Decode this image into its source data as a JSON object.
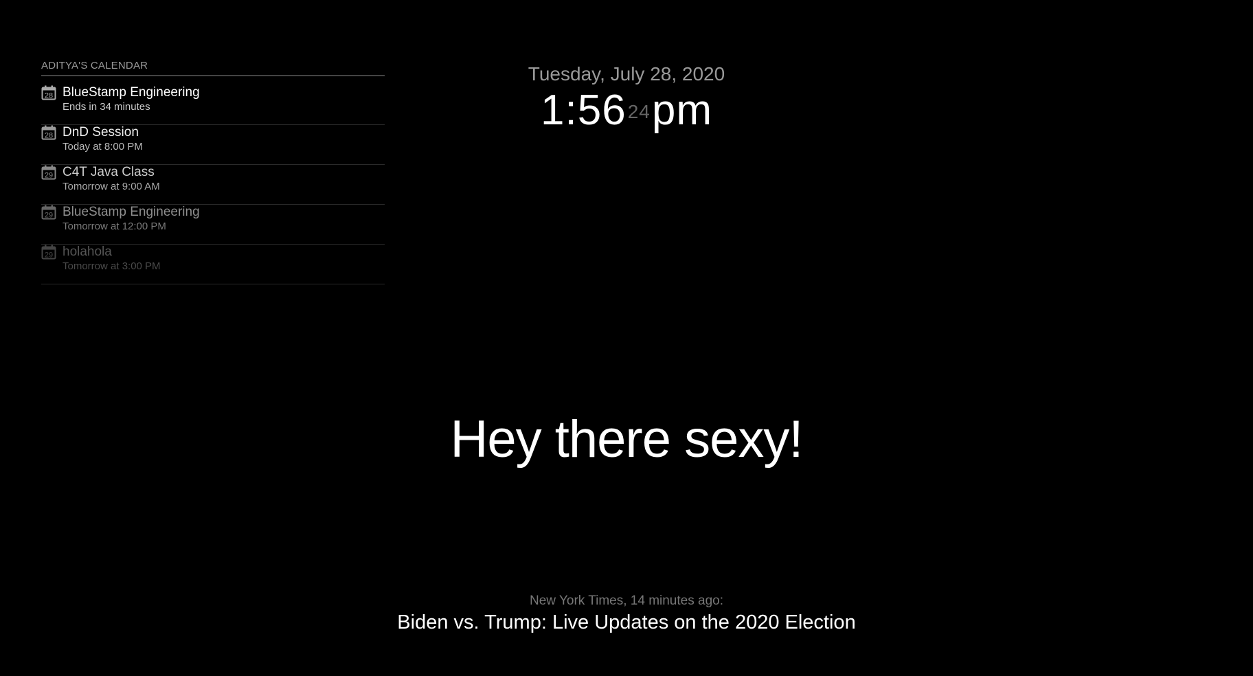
{
  "calendar": {
    "header": "ADITYA'S CALENDAR",
    "events": [
      {
        "title": "BlueStamp Engineering",
        "time": "Ends in 34 minutes",
        "day": "28",
        "color": "#ffffff",
        "subcolor": "#cccccc",
        "iconcolor": "#aaaaaa"
      },
      {
        "title": "DnD Session",
        "time": "Today at 8:00 PM",
        "day": "28",
        "color": "#eeeeee",
        "subcolor": "#bbbbbb",
        "iconcolor": "#9a9a9a"
      },
      {
        "title": "C4T Java Class",
        "time": "Tomorrow at 9:00 AM",
        "day": "29",
        "color": "#cccccc",
        "subcolor": "#aaaaaa",
        "iconcolor": "#888888"
      },
      {
        "title": "BlueStamp Engineering",
        "time": "Tomorrow at 12:00 PM",
        "day": "29",
        "color": "#8e8e8e",
        "subcolor": "#7a7a7a",
        "iconcolor": "#666666"
      },
      {
        "title": "holahola",
        "time": "Tomorrow at 3:00 PM",
        "day": "29",
        "color": "#555555",
        "subcolor": "#4a4a4a",
        "iconcolor": "#444444"
      }
    ]
  },
  "clock": {
    "date": "Tuesday, July 28, 2020",
    "hours_minutes": "1:56",
    "seconds": "24",
    "period": "pm"
  },
  "compliment": {
    "text": "Hey there sexy!"
  },
  "news": {
    "source": "New York Times, 14 minutes ago:",
    "headline": "Biden vs. Trump: Live Updates on the 2020 Election"
  },
  "icons": {
    "event": "calendar-icon"
  }
}
